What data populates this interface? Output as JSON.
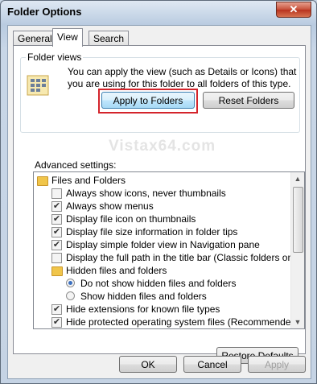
{
  "window": {
    "title": "Folder Options",
    "close_glyph": "✕"
  },
  "tabs": [
    {
      "label": "General"
    },
    {
      "label": "View"
    },
    {
      "label": "Search"
    }
  ],
  "folder_views": {
    "group_label": "Folder views",
    "description": "You can apply the view (such as Details or Icons) that you are using for this folder to all folders of this type.",
    "apply_button": "Apply to Folders",
    "reset_button": "Reset Folders",
    "icon": "folder-view-icon"
  },
  "watermark": "Vistax64.com",
  "advanced": {
    "label": "Advanced settings:",
    "items": [
      {
        "type": "folder",
        "label": "Files and Folders",
        "indent": 0
      },
      {
        "type": "checkbox",
        "label": "Always show icons, never thumbnails",
        "checked": false,
        "indent": 1
      },
      {
        "type": "checkbox",
        "label": "Always show menus",
        "checked": true,
        "indent": 1
      },
      {
        "type": "checkbox",
        "label": "Display file icon on thumbnails",
        "checked": true,
        "indent": 1
      },
      {
        "type": "checkbox",
        "label": "Display file size information in folder tips",
        "checked": true,
        "indent": 1
      },
      {
        "type": "checkbox",
        "label": "Display simple folder view in Navigation pane",
        "checked": true,
        "indent": 1
      },
      {
        "type": "checkbox",
        "label": "Display the full path in the title bar (Classic folders only)",
        "checked": false,
        "indent": 1
      },
      {
        "type": "folder",
        "label": "Hidden files and folders",
        "indent": 1
      },
      {
        "type": "radio",
        "label": "Do not show hidden files and folders",
        "checked": true,
        "indent": 2
      },
      {
        "type": "radio",
        "label": "Show hidden files and folders",
        "checked": false,
        "indent": 2
      },
      {
        "type": "checkbox",
        "label": "Hide extensions for known file types",
        "checked": true,
        "indent": 1
      },
      {
        "type": "checkbox",
        "label": "Hide protected operating system files (Recommended)",
        "checked": true,
        "indent": 1
      }
    ]
  },
  "restore_defaults": "Restore Defaults",
  "footer": {
    "ok": "OK",
    "cancel": "Cancel",
    "apply": "Apply"
  },
  "colors": {
    "highlight_box": "#d4242b",
    "title_bar": "#b9cbe0",
    "close_button": "#c75039"
  }
}
